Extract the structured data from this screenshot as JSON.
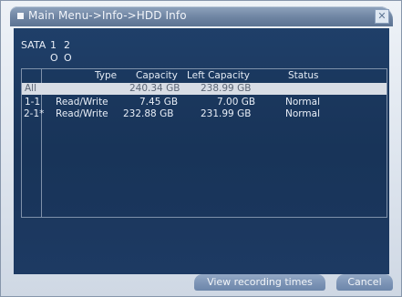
{
  "window": {
    "title": "Main Menu->Info->HDD Info"
  },
  "sata": {
    "label": "SATA",
    "ports": [
      "1",
      "2"
    ],
    "statuses": [
      "O",
      "O"
    ]
  },
  "table": {
    "columns": [
      "Type",
      "Capacity",
      "Left Capacity",
      "Status"
    ],
    "rows": [
      {
        "id": "All",
        "type": "",
        "capacity": "240.34 GB",
        "left_capacity": "238.99 GB",
        "status": "",
        "selected": true
      },
      {
        "id": "1-1",
        "type": "Read/Write",
        "capacity": "7.45 GB",
        "left_capacity": "7.00 GB",
        "status": "Normal",
        "selected": false
      },
      {
        "id": "2-1*",
        "type": "Read/Write",
        "capacity": "232.88 GB",
        "left_capacity": "231.99 GB",
        "status": "Normal",
        "selected": false
      }
    ]
  },
  "buttons": {
    "view_recording_times": "View recording times",
    "cancel": "Cancel"
  },
  "colors": {
    "panel_bg": "#1f3f69",
    "selected_row": "#d8dde5",
    "title_bar": "#6e84a2"
  }
}
